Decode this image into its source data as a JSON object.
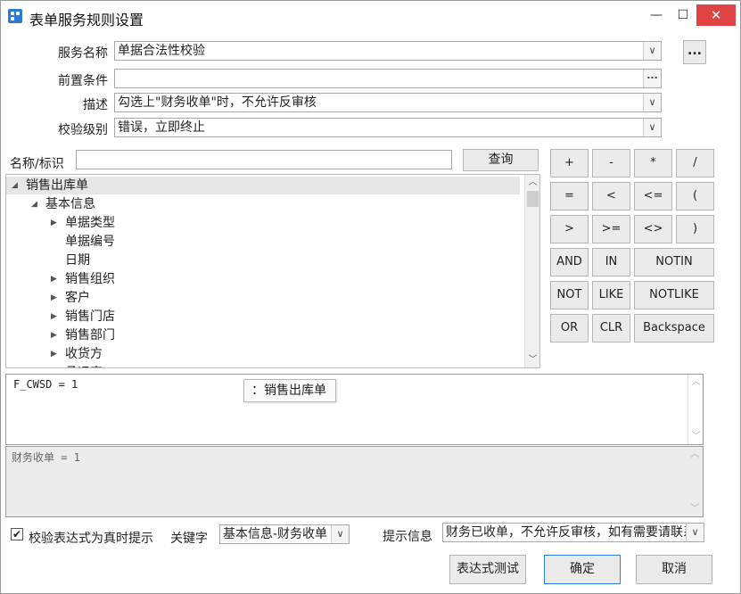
{
  "window": {
    "title": "表单服务规则设置",
    "min": "—",
    "max": "☐",
    "close": "✕"
  },
  "form": {
    "service_name_label": "服务名称",
    "service_name_value": "单据合法性校验",
    "more_button": "...",
    "precondition_label": "前置条件",
    "precondition_value": "",
    "precondition_button": "...",
    "desc_label": "描述",
    "desc_value": "勾选上\"财务收单\"时，不允许反审核",
    "level_label": "校验级别",
    "level_value": "错误，立即终止"
  },
  "search": {
    "label": "名称/标识",
    "value": "",
    "button": "查询"
  },
  "tree": {
    "nodes": [
      {
        "label": "销售出库单",
        "toggle": "◢",
        "level": 0,
        "selected": true
      },
      {
        "label": "基本信息",
        "toggle": "◢",
        "level": 1,
        "selected": false
      },
      {
        "label": "单据类型",
        "toggle": "▶",
        "level": 2,
        "selected": false
      },
      {
        "label": "单据编号",
        "toggle": "",
        "level": 2,
        "selected": false
      },
      {
        "label": "日期",
        "toggle": "",
        "level": 2,
        "selected": false
      },
      {
        "label": "销售组织",
        "toggle": "▶",
        "level": 2,
        "selected": false
      },
      {
        "label": "客户",
        "toggle": "▶",
        "level": 2,
        "selected": false
      },
      {
        "label": "销售门店",
        "toggle": "▶",
        "level": 2,
        "selected": false
      },
      {
        "label": "销售部门",
        "toggle": "▶",
        "level": 2,
        "selected": false
      },
      {
        "label": "收货方",
        "toggle": "▶",
        "level": 2,
        "selected": false
      },
      {
        "label": "承运商",
        "toggle": "▶",
        "level": 2,
        "selected": false
      }
    ]
  },
  "operators": {
    "row1": [
      "+",
      "-",
      "*",
      "/"
    ],
    "row2": [
      "=",
      "<",
      "<=",
      "("
    ],
    "row3": [
      ">",
      ">=",
      "<>",
      ")"
    ],
    "row4": [
      "AND",
      "IN",
      "NOTIN"
    ],
    "row5": [
      "NOT",
      "LIKE",
      "NOTLIKE"
    ],
    "row6": [
      "OR",
      "CLR",
      "Backspace"
    ]
  },
  "expression": {
    "text": "F_CWSD  = 1",
    "tooltip": "：销售出库单"
  },
  "expression_display": {
    "text": "财务收单  = 1"
  },
  "bottom": {
    "checkbox_label": "校验表达式为真时提示",
    "checkbox_checked": "✔",
    "keyword_label": "关键字",
    "keyword_value": "基本信息-财务收单",
    "tip_label": "提示信息",
    "tip_value": "财务已收单，不允许反审核，如有需要请联系"
  },
  "actions": {
    "test": "表达式测试",
    "ok": "确定",
    "cancel": "取消"
  },
  "glyphs": {
    "dropdown": "∨",
    "scroll_up": "︿",
    "scroll_down": "﹀"
  }
}
